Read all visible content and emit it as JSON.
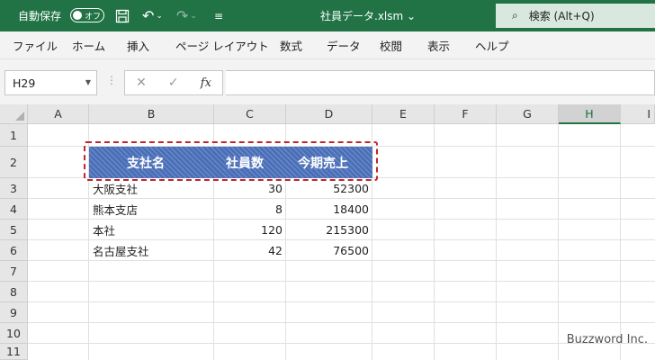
{
  "titlebar": {
    "autosave_label": "自動保存",
    "autosave_state": "オフ",
    "save_icon": "💾",
    "undo_icon": "↶",
    "redo_icon": "↷",
    "dropdown_glyph": "⌄",
    "qat_more_icon": "≡",
    "document_title": "社員データ.xlsm ⌄",
    "search_icon": "⌕",
    "search_label": "検索 (Alt+Q)",
    "accent_color": "#217346"
  },
  "ribbon": {
    "tabs": [
      "ファイル",
      "ホーム",
      "挿入",
      "ページ レイアウト",
      "数式",
      "データ",
      "校閲",
      "表示",
      "ヘルプ"
    ]
  },
  "formula_bar": {
    "name_box": "H29",
    "name_box_arrow": "▼",
    "separator": "⋮",
    "cancel_icon": "✕",
    "enter_icon": "✓",
    "fx_label": "fx",
    "formula_value": ""
  },
  "sheet": {
    "columns": [
      "A",
      "B",
      "C",
      "D",
      "E",
      "F",
      "G",
      "H",
      "I"
    ],
    "selected_column": "H",
    "rows": [
      "1",
      "2",
      "3",
      "4",
      "5",
      "6",
      "7",
      "8",
      "9",
      "10",
      "11"
    ],
    "header": {
      "branch": "支社名",
      "employees": "社員数",
      "sales": "今期売上",
      "fill_color": "#4a6fb8"
    },
    "data": [
      {
        "branch": "大阪支社",
        "employees": "30",
        "sales": "52300"
      },
      {
        "branch": "熊本支店",
        "employees": "8",
        "sales": "18400"
      },
      {
        "branch": "本社",
        "employees": "120",
        "sales": "215300"
      },
      {
        "branch": "名古屋支社",
        "employees": "42",
        "sales": "76500"
      }
    ],
    "copy_marquee_color": "#c0262d"
  },
  "watermark": "Buzzword Inc."
}
